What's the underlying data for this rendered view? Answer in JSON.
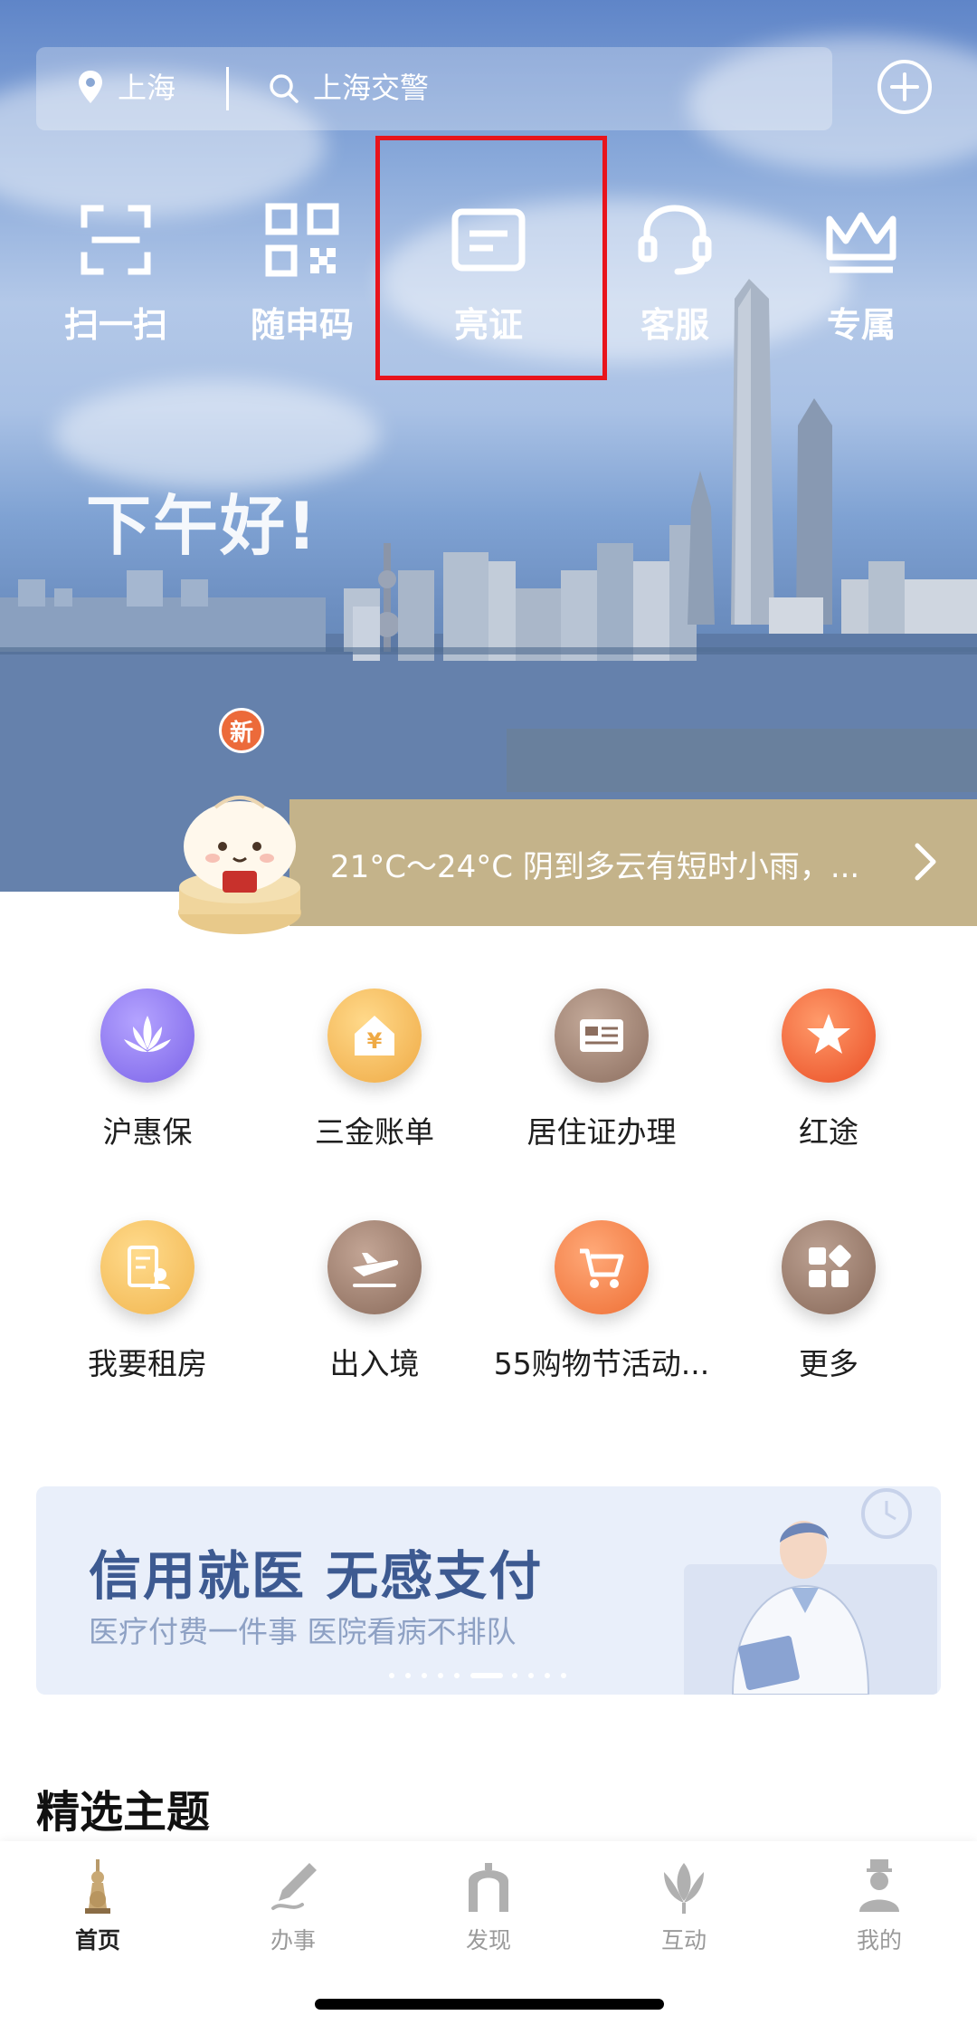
{
  "search_bar": {
    "location": "上海",
    "query": "上海交警"
  },
  "quick_actions": [
    {
      "label": "扫一扫",
      "icon": "scan-icon"
    },
    {
      "label": "随申码",
      "icon": "qr-code-icon"
    },
    {
      "label": "亮证",
      "icon": "id-card-icon"
    },
    {
      "label": "客服",
      "icon": "headset-icon"
    },
    {
      "label": "专属",
      "icon": "crown-icon"
    }
  ],
  "greeting": "下午好!",
  "mascot_badge": "新",
  "weather": "21°C～24°C 阴到多云有短时小雨，...",
  "services": [
    {
      "label": "沪惠保",
      "icon": "lotus-icon",
      "color": "#8e79f0"
    },
    {
      "label": "三金账单",
      "icon": "yen-house-icon",
      "color": "#f3bb57"
    },
    {
      "label": "居住证办理",
      "icon": "residence-card-icon",
      "color": "#a98c7a"
    },
    {
      "label": "红途",
      "icon": "red-star-icon",
      "color": "#f26a3a"
    },
    {
      "label": "我要租房",
      "icon": "rent-house-icon",
      "color": "#f4c062"
    },
    {
      "label": "出入境",
      "icon": "airplane-icon",
      "color": "#9f8070"
    },
    {
      "label": "55购物节活动...",
      "icon": "shopping-cart-icon",
      "color": "#f3803f"
    },
    {
      "label": "更多",
      "icon": "more-grid-icon",
      "color": "#a08474"
    }
  ],
  "banner": {
    "title": "信用就医 无感支付",
    "subtitle": "医疗付费一件事 医院看病不排队"
  },
  "section_title": "精选主题",
  "tabs": [
    {
      "label": "首页",
      "icon": "home-tower-icon",
      "active": true
    },
    {
      "label": "办事",
      "icon": "pen-icon",
      "active": false
    },
    {
      "label": "发现",
      "icon": "arch-icon",
      "active": false
    },
    {
      "label": "互动",
      "icon": "magnolia-icon",
      "active": false
    },
    {
      "label": "我的",
      "icon": "person-icon",
      "active": false
    }
  ],
  "colors": {
    "accent_gold": "#c4b38a",
    "highlight_red": "#e8141c",
    "banner_blue": "#3d5a91"
  }
}
